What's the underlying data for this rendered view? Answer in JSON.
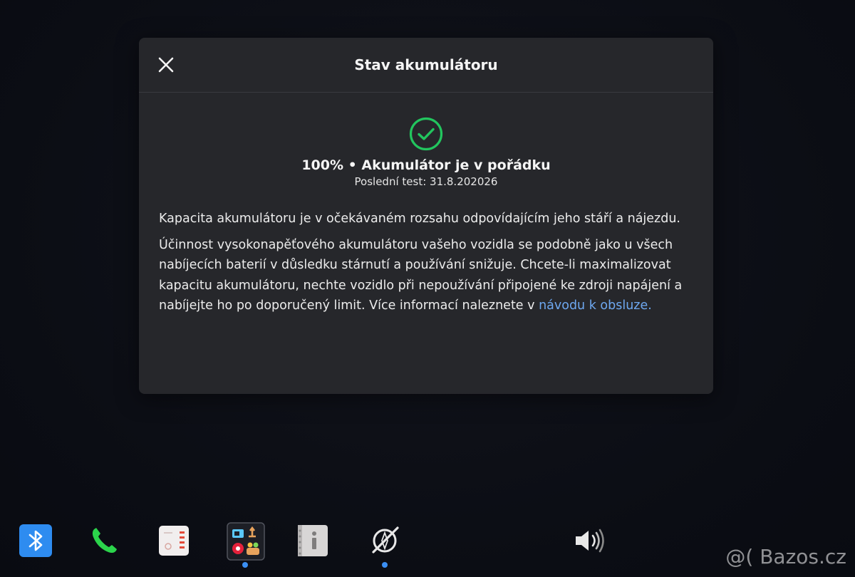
{
  "dialog": {
    "title": "Stav akumulátoru",
    "status_line": "100% • Akumulátor je v pořádku",
    "last_test": "Poslední test: 31.8.202026",
    "paragraph1": "Kapacita akumulátoru je v očekávaném rozsahu odpovídajícím jeho stáří a nájezdu.",
    "paragraph2_text": "Účinnost vysokonapěťového akumulátoru vašeho vozidla se podobně jako u všech nabíjecích baterií v důsledku stárnutí a používání snižuje. Chcete-li maximalizovat kapacitu akumulátoru, nechte vozidlo při nepoužívání připojené ke zdroji napájení a nabíjejte ho po doporučený limit. Více informací naleznete v ",
    "paragraph2_link": "návodu k obsluze.",
    "status_color": "#22c55e",
    "link_color": "#6ea8f0"
  },
  "dock": {
    "icons": [
      "bluetooth-icon",
      "phone-icon",
      "calendar-icon",
      "app-launcher-icon",
      "manual-icon",
      "navigation-off-icon",
      "volume-icon"
    ]
  },
  "watermark": "@( Bazos.cz"
}
